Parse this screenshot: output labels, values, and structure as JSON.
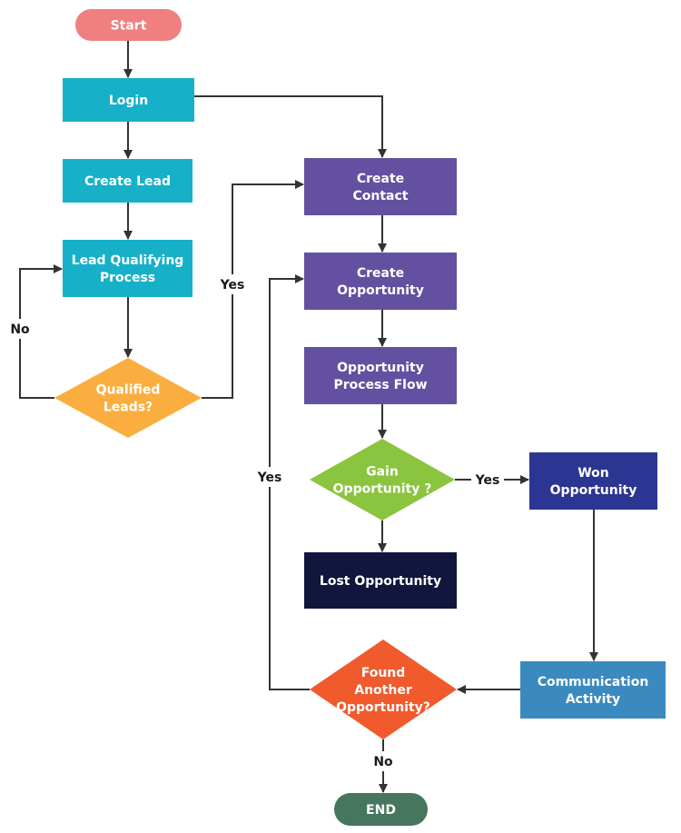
{
  "diagram": {
    "type": "flowchart",
    "nodes": {
      "start": {
        "label": [
          "Start"
        ],
        "shape": "terminator",
        "color": "#f08080"
      },
      "login": {
        "label": [
          "Login"
        ],
        "shape": "process",
        "color": "#17b0c9"
      },
      "create_lead": {
        "label": [
          "Create Lead"
        ],
        "shape": "process",
        "color": "#17b0c9"
      },
      "lead_qualifying": {
        "label": [
          "Lead Qualifying",
          "Process"
        ],
        "shape": "process",
        "color": "#17b0c9"
      },
      "qualified_leads": {
        "label": [
          "Qualified",
          "Leads?"
        ],
        "shape": "decision",
        "color": "#f9ae3f"
      },
      "create_contact": {
        "label": [
          "Create",
          "Contact"
        ],
        "shape": "process",
        "color": "#6350a0"
      },
      "create_opportunity": {
        "label": [
          "Create",
          "Opportunity"
        ],
        "shape": "process",
        "color": "#6350a0"
      },
      "opportunity_process_flow": {
        "label": [
          "Opportunity",
          "Process Flow"
        ],
        "shape": "process",
        "color": "#6350a0"
      },
      "gain_opportunity": {
        "label": [
          "Gain",
          "Opportunity ?"
        ],
        "shape": "decision",
        "color": "#8bc43f"
      },
      "won_opportunity": {
        "label": [
          "Won",
          "Opportunity"
        ],
        "shape": "process",
        "color": "#2b3592"
      },
      "lost_opportunity": {
        "label": [
          "Lost Opportunity"
        ],
        "shape": "process",
        "color": "#12163d"
      },
      "communication_activity": {
        "label": [
          "Communication",
          "Activity"
        ],
        "shape": "process",
        "color": "#3a89bf"
      },
      "found_another": {
        "label": [
          "Found",
          "Another",
          "Opportunity?"
        ],
        "shape": "decision",
        "color": "#f05a2c"
      },
      "end": {
        "label": [
          "END"
        ],
        "shape": "terminator",
        "color": "#46765d"
      }
    },
    "edges": [
      {
        "from": "start",
        "to": "login",
        "label": ""
      },
      {
        "from": "login",
        "to": "create_lead",
        "label": ""
      },
      {
        "from": "login",
        "to": "create_contact",
        "label": ""
      },
      {
        "from": "create_lead",
        "to": "lead_qualifying",
        "label": ""
      },
      {
        "from": "lead_qualifying",
        "to": "qualified_leads",
        "label": ""
      },
      {
        "from": "qualified_leads",
        "to": "lead_qualifying",
        "label": "No"
      },
      {
        "from": "qualified_leads",
        "to": "create_contact",
        "label": "Yes"
      },
      {
        "from": "create_contact",
        "to": "create_opportunity",
        "label": ""
      },
      {
        "from": "create_opportunity",
        "to": "opportunity_process_flow",
        "label": ""
      },
      {
        "from": "opportunity_process_flow",
        "to": "gain_opportunity",
        "label": ""
      },
      {
        "from": "gain_opportunity",
        "to": "won_opportunity",
        "label": "Yes"
      },
      {
        "from": "gain_opportunity",
        "to": "lost_opportunity",
        "label": ""
      },
      {
        "from": "won_opportunity",
        "to": "communication_activity",
        "label": ""
      },
      {
        "from": "communication_activity",
        "to": "found_another",
        "label": ""
      },
      {
        "from": "found_another",
        "to": "create_opportunity",
        "label": "Yes"
      },
      {
        "from": "found_another",
        "to": "end",
        "label": "No"
      }
    ],
    "edge_color": "#333333"
  }
}
